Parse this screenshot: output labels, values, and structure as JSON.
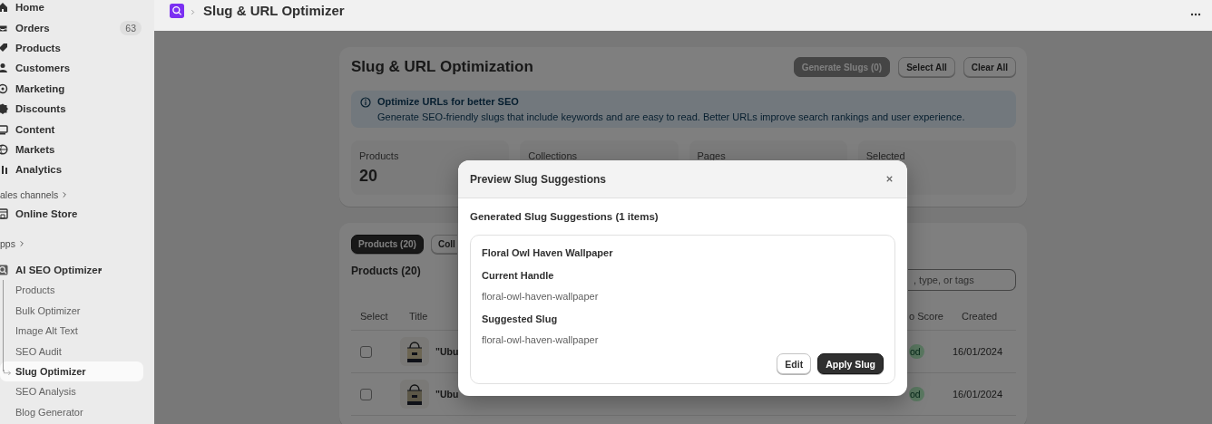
{
  "top_bar": {
    "title": "Slug & URL Optimizer"
  },
  "sidebar": {
    "items": [
      {
        "label": "Home"
      },
      {
        "label": "Orders",
        "badge": "63"
      },
      {
        "label": "Products"
      },
      {
        "label": "Customers"
      },
      {
        "label": "Marketing"
      },
      {
        "label": "Discounts"
      },
      {
        "label": "Content"
      },
      {
        "label": "Markets"
      },
      {
        "label": "Analytics"
      }
    ],
    "sales_channels": {
      "label": "ales channels",
      "items": [
        {
          "label": "Online Store"
        }
      ]
    },
    "apps": {
      "label": "pps",
      "items": [
        {
          "label": "AI SEO Optimizer",
          "children": [
            {
              "label": "Products",
              "selected": false
            },
            {
              "label": "Bulk Optimizer",
              "selected": false
            },
            {
              "label": "Image Alt Text",
              "selected": false
            },
            {
              "label": "SEO Audit",
              "selected": false
            },
            {
              "label": "Slug Optimizer",
              "selected": true
            },
            {
              "label": "SEO Analysis",
              "selected": false
            },
            {
              "label": "Blog Generator",
              "selected": false
            }
          ]
        }
      ]
    }
  },
  "page": {
    "title": "Slug & URL Optimization",
    "buttons": [
      {
        "label": "Generate Slugs (0)",
        "kind": "primary",
        "disabled": true
      },
      {
        "label": "Select All",
        "kind": "secondary",
        "disabled": false
      },
      {
        "label": "Clear All",
        "kind": "secondary",
        "disabled": false
      }
    ],
    "banner": {
      "title": "Optimize URLs for better SEO",
      "text": "Generate SEO-friendly slugs that include keywords and are easy to read. Better URLs improve search rankings and user experience."
    },
    "stats": [
      {
        "label": "Products",
        "value": "20"
      },
      {
        "label": "Collections"
      },
      {
        "label": "Pages"
      },
      {
        "label": "Selected"
      }
    ]
  },
  "list": {
    "tabs": [
      {
        "label": "Products (20)",
        "selected": true
      },
      {
        "label": "Coll",
        "selected": false
      }
    ],
    "heading": "Products (20)",
    "search": {
      "placeholder": ", type, or tags"
    },
    "table": {
      "columns": [
        "Select",
        "Title",
        "o Score",
        "Created"
      ],
      "rows": [
        {
          "checked": false,
          "title": "\"Ubu",
          "score": "od",
          "created": "16/01/2024"
        },
        {
          "checked": false,
          "title": "\"Ubu",
          "score": "od",
          "created": "16/01/2024"
        }
      ]
    }
  },
  "modal": {
    "title": "Preview Slug Suggestions",
    "subtitle": "Generated Slug Suggestions (1 items)",
    "suggestions": [
      {
        "name": "Floral Owl Haven Wallpaper",
        "current_label": "Current Handle",
        "current": "floral-owl-haven-wallpaper",
        "suggested_label": "Suggested Slug",
        "suggested": "floral-owl-haven-wallpaper"
      }
    ],
    "buttons": [
      {
        "label": "Edit",
        "kind": "secondary"
      },
      {
        "label": "Apply Slug",
        "kind": "primary"
      }
    ]
  }
}
